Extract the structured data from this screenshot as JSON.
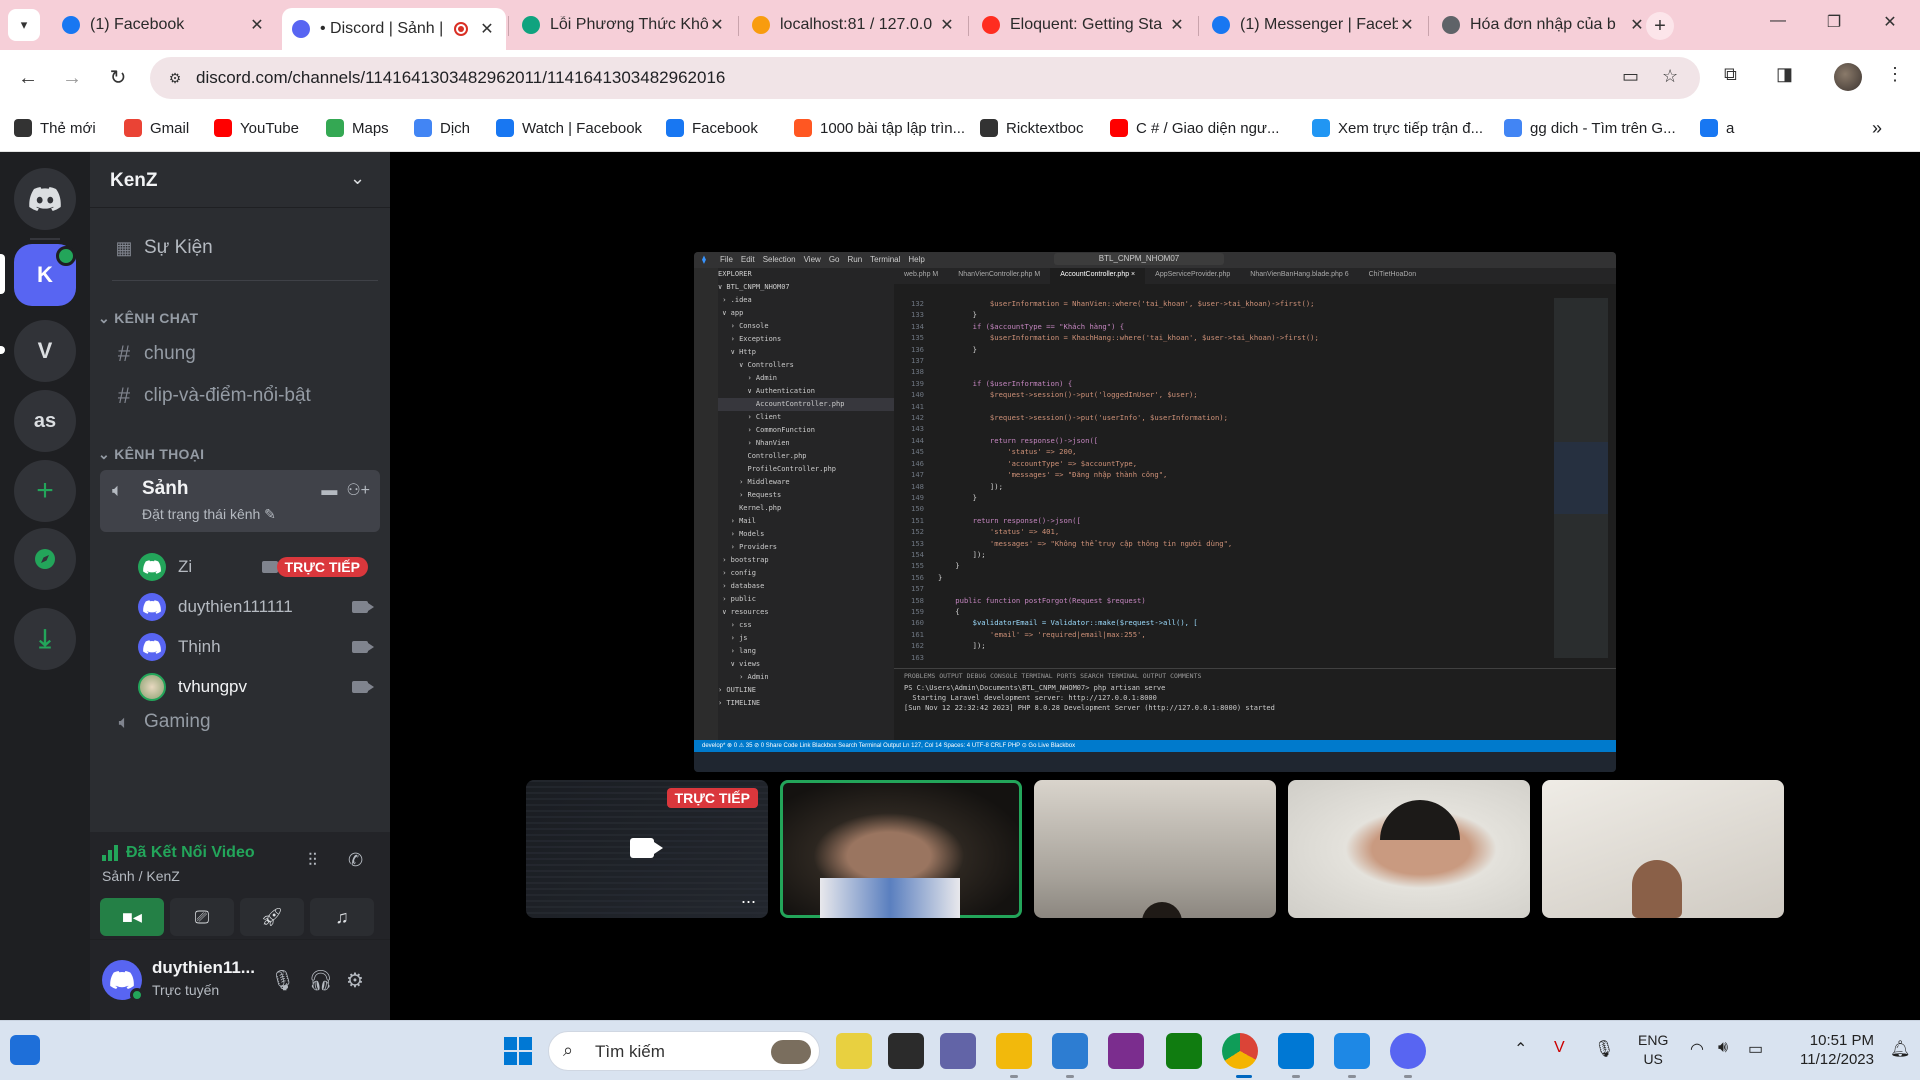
{
  "browser": {
    "tabs": [
      {
        "title": "(1) Facebook",
        "icon": "facebook-icon",
        "color": "#1877f2"
      },
      {
        "title": "• Discord | Sảnh |",
        "icon": "discord-icon",
        "color": "#5865f2"
      },
      {
        "title": "Lỗi Phương Thức Khô",
        "icon": "chatgpt-icon",
        "color": "#10a37f"
      },
      {
        "title": "localhost:81 / 127.0.0",
        "icon": "phpmyadmin-icon",
        "color": "#f89c0e"
      },
      {
        "title": "Eloquent: Getting Sta",
        "icon": "laravel-icon",
        "color": "#ff2d20"
      },
      {
        "title": "(1) Messenger | Faceb",
        "icon": "facebook-icon",
        "color": "#1877f2"
      },
      {
        "title": "Hóa đơn nhập của b",
        "icon": "globe-icon",
        "color": "#5f6368"
      }
    ],
    "url": "discord.com/channels/1141641303482962011/1141641303482962016",
    "bookmarks": [
      {
        "label": "Thẻ mới",
        "color": "#333333"
      },
      {
        "label": "Gmail",
        "color": "#ea4335"
      },
      {
        "label": "YouTube",
        "color": "#ff0000"
      },
      {
        "label": "Maps",
        "color": "#34a853"
      },
      {
        "label": "Dịch",
        "color": "#4285f4"
      },
      {
        "label": "Watch | Facebook",
        "color": "#1877f2"
      },
      {
        "label": "Facebook",
        "color": "#1877f2"
      },
      {
        "label": "1000 bài tập lập trìn...",
        "color": "#ff5722"
      },
      {
        "label": "Ricktextboc",
        "color": "#333333"
      },
      {
        "label": "C # / Giao diện ngư...",
        "color": "#ff0000"
      },
      {
        "label": "Xem trực tiếp trận đ...",
        "color": "#2196f3"
      },
      {
        "label": "gg dich - Tìm trên G...",
        "color": "#4285f4"
      },
      {
        "label": "a",
        "color": "#1877f2"
      }
    ]
  },
  "discord": {
    "servers": [
      {
        "label": "K",
        "active": true
      },
      {
        "label": "V"
      },
      {
        "label": "as"
      }
    ],
    "server_name": "KenZ",
    "events_label": "Sự Kiện",
    "category_text": "KÊNH CHAT",
    "text_channels": [
      "chung",
      "clip-và-điểm-nổi-bật"
    ],
    "category_voice": "KÊNH THOẠI",
    "voice_channel": {
      "name": "Sảnh",
      "status": "Đặt trạng thái kênh",
      "members": [
        {
          "name": "Zi",
          "live": true,
          "live_label": "TRỰC TIẾP"
        },
        {
          "name": "duythien111111"
        },
        {
          "name": "Thịnh"
        },
        {
          "name": "tvhungpv"
        }
      ]
    },
    "voice_channel_2": "Gaming",
    "connection": {
      "status": "Đã Kết Nối Video",
      "location": "Sảnh / KenZ"
    },
    "user": {
      "name": "duythien11...",
      "status": "Trực tuyến"
    },
    "stream_tile_live": "TRỰC TIẾP",
    "stream_tile_more": "...",
    "accent": "#5865f2",
    "online_color": "#23a55a",
    "live_color": "#da373c"
  },
  "shared_screen": {
    "window_title": "BTL_CNPM_NHOM07",
    "menu": [
      "File",
      "Edit",
      "Selection",
      "View",
      "Go",
      "Run",
      "Terminal",
      "Help"
    ],
    "tabs": [
      "web.php M",
      "NhanVienController.php M",
      "AccountController.php ×",
      "AppServiceProvider.php",
      "NhanVienBanHang.blade.php 6",
      "ChiTietHoaDon"
    ],
    "explorer": [
      "EXPLORER",
      "∨ BTL_CNPM_NHOM07",
      " › .idea",
      " ∨ app",
      "   › Console",
      "   › Exceptions",
      "   ∨ Http",
      "     ∨ Controllers",
      "       › Admin",
      "       ∨ Authentication",
      "         AccountController.php",
      "       › Client",
      "       › CommonFunction",
      "       › NhanVien",
      "       Controller.php",
      "       ProfileController.php",
      "     › Middleware",
      "     › Requests",
      "     Kernel.php",
      "   › Mail",
      "   › Models",
      "   › Providers",
      " › bootstrap",
      " › config",
      " › database",
      " › public",
      " ∨ resources",
      "   › css",
      "   › js",
      "   › lang",
      "   ∨ views",
      "     › Admin",
      "› OUTLINE",
      "› TIMELINE"
    ],
    "code": [
      {
        "n": "132",
        "t": "            $userInformation = NhanVien::where('tai_khoan', $user->tai_khoan)->first();"
      },
      {
        "n": "133",
        "t": "        }"
      },
      {
        "n": "134",
        "t": "        if ($accountType == \"Khách hàng\") {"
      },
      {
        "n": "135",
        "t": "            $userInformation = KhachHang::where('tai_khoan', $user->tai_khoan)->first();"
      },
      {
        "n": "136",
        "t": "        }"
      },
      {
        "n": "137",
        "t": ""
      },
      {
        "n": "138",
        "t": ""
      },
      {
        "n": "139",
        "t": "        if ($userInformation) {"
      },
      {
        "n": "140",
        "t": "            $request->session()->put('loggedInUser', $user);"
      },
      {
        "n": "141",
        "t": ""
      },
      {
        "n": "142",
        "t": "            $request->session()->put('userInfo', $userInformation);"
      },
      {
        "n": "143",
        "t": ""
      },
      {
        "n": "144",
        "t": "            return response()->json(["
      },
      {
        "n": "145",
        "t": "                'status' => 200,"
      },
      {
        "n": "146",
        "t": "                'accountType' => $accountType,"
      },
      {
        "n": "147",
        "t": "                'messages' => \"Đăng nhập thành công\","
      },
      {
        "n": "148",
        "t": "            ]);"
      },
      {
        "n": "149",
        "t": "        }"
      },
      {
        "n": "150",
        "t": ""
      },
      {
        "n": "151",
        "t": "        return response()->json(["
      },
      {
        "n": "152",
        "t": "            'status' => 401,"
      },
      {
        "n": "153",
        "t": "            'messages' => \"Không thể truy cập thông tin người dùng\","
      },
      {
        "n": "154",
        "t": "        ]);"
      },
      {
        "n": "155",
        "t": "    }"
      },
      {
        "n": "156",
        "t": "}"
      },
      {
        "n": "157",
        "t": ""
      },
      {
        "n": "158",
        "t": "    public function postForgot(Request $request)"
      },
      {
        "n": "159",
        "t": "    {"
      },
      {
        "n": "160",
        "t": "        $validatorEmail = Validator::make($request->all(), ["
      },
      {
        "n": "161",
        "t": "            'email' => 'required|email|max:255',"
      },
      {
        "n": "162",
        "t": "        ]);"
      },
      {
        "n": "163",
        "t": ""
      }
    ],
    "terminal_tabs": "PROBLEMS  OUTPUT  DEBUG CONSOLE  TERMINAL  PORTS  SEARCH TERMINAL OUTPUT  COMMENTS",
    "terminal": [
      "PS C:\\Users\\Admin\\Documents\\BTL_CNPM_NHOM07> php artisan serve",
      "  Starting Laravel development server: http://127.0.0.1:8000",
      "[Sun Nov 12 22:32:42 2023] PHP 8.0.28 Development Server (http://127.0.0.1:8000) started"
    ],
    "statusbar": "develop*   ⊗ 0 ⚠ 35   ⊘ 0   Share Code Link   Blackbox   Search Terminal Output          Ln 127, Col 14   Spaces: 4   UTF-8   CRLF   PHP   ⊙ Go Live   Blackbox"
  },
  "taskbar": {
    "search_placeholder": "Tìm kiếm",
    "lang_top": "ENG",
    "lang_bottom": "US",
    "time": "10:51 PM",
    "date": "11/12/2023"
  }
}
